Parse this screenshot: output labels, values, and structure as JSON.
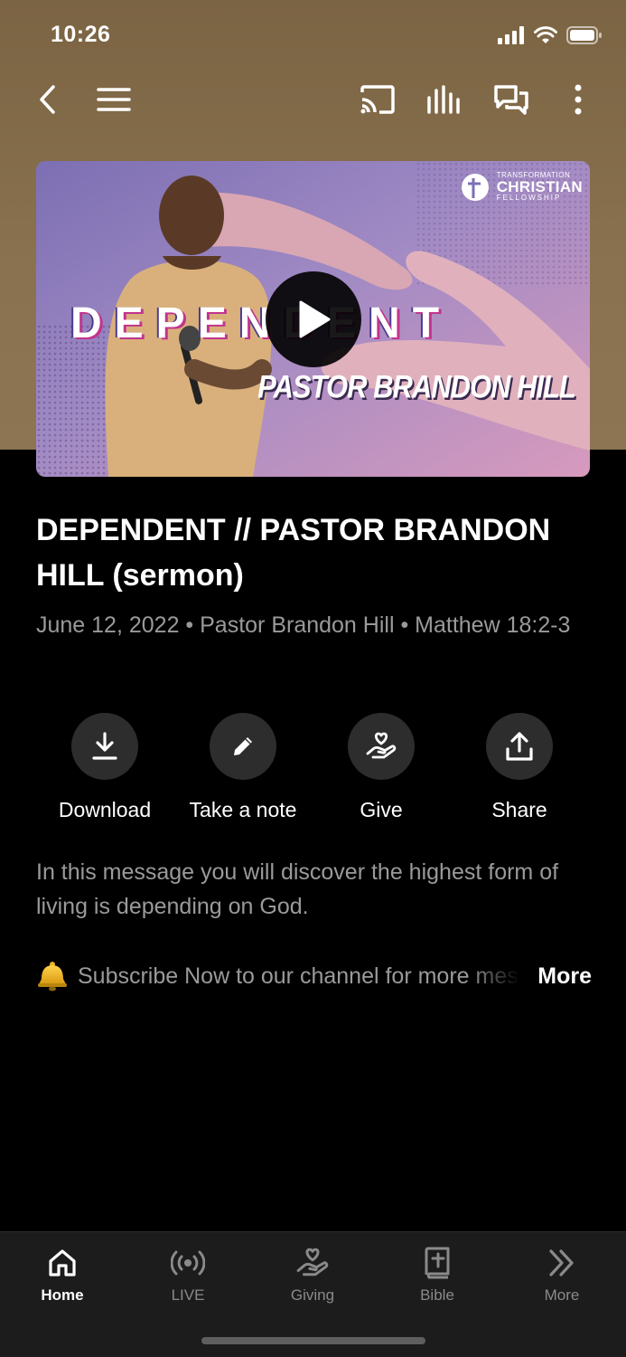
{
  "status": {
    "time": "10:26"
  },
  "video": {
    "title_overlay": "DEPENDENT",
    "speaker_overlay": "PASTOR BRANDON HILL",
    "logo": {
      "line1": "TRANSFORMATION",
      "line2": "CHRISTIAN",
      "line3": "FELLOWSHIP"
    }
  },
  "sermon": {
    "title": "DEPENDENT // PASTOR BRANDON HILL (sermon)",
    "meta": "June 12, 2022 • Pastor Brandon Hill • Matthew 18:2-3",
    "description": "In this message you will discover the highest form of living is depending on God.",
    "subscribe_text": "Subscribe Now to our channel for more messages",
    "more_label": "More"
  },
  "actions": [
    {
      "label": "Download",
      "icon": "download-icon"
    },
    {
      "label": "Take a note",
      "icon": "pencil-icon"
    },
    {
      "label": "Give",
      "icon": "give-heart-hand-icon"
    },
    {
      "label": "Share",
      "icon": "share-icon"
    }
  ],
  "tabs": [
    {
      "label": "Home",
      "icon": "home-icon",
      "active": true
    },
    {
      "label": "LIVE",
      "icon": "live-broadcast-icon",
      "active": false
    },
    {
      "label": "Giving",
      "icon": "giving-icon",
      "active": false
    },
    {
      "label": "Bible",
      "icon": "bible-icon",
      "active": false
    },
    {
      "label": "More",
      "icon": "chevrons-right-icon",
      "active": false
    }
  ],
  "colors": {
    "header_bg": "#8a7250",
    "action_circle": "#2d2d2d",
    "tabbar_bg": "#1c1c1c",
    "muted_text": "#9a9a9a"
  }
}
